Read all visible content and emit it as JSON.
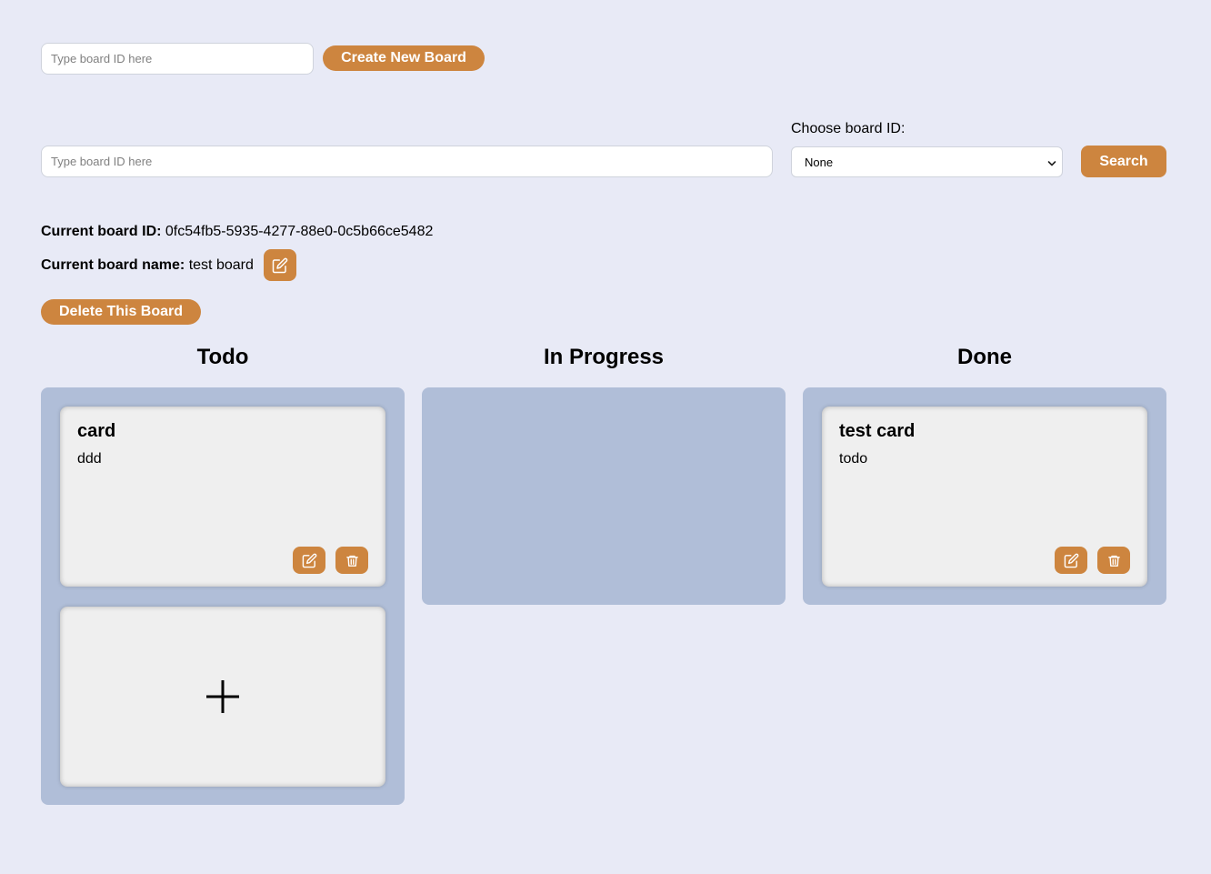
{
  "create_board": {
    "input_placeholder": "Type board ID here",
    "button_label": "Create New Board"
  },
  "search_board": {
    "input_placeholder": "Type board ID here",
    "choose_label": "Choose board ID:",
    "select_value": "None",
    "search_label": "Search"
  },
  "current_board": {
    "id_label": "Current board ID:",
    "id_value": "0fc54fb5-5935-4277-88e0-0c5b66ce5482",
    "name_label": "Current board name:",
    "name_value": "test board",
    "delete_label": "Delete This Board"
  },
  "columns": [
    {
      "title": "Todo",
      "cards": [
        {
          "title": "card",
          "description": "ddd"
        }
      ]
    },
    {
      "title": "In Progress",
      "cards": []
    },
    {
      "title": "Done",
      "cards": [
        {
          "title": "test card",
          "description": "todo"
        }
      ]
    }
  ],
  "icons": {
    "edit": "edit-icon",
    "delete": "trash-icon",
    "add": "plus-icon"
  },
  "colors": {
    "background": "#e8eaf6",
    "accent": "#cd853f",
    "column": "#b0bed8",
    "card": "#efefef"
  }
}
